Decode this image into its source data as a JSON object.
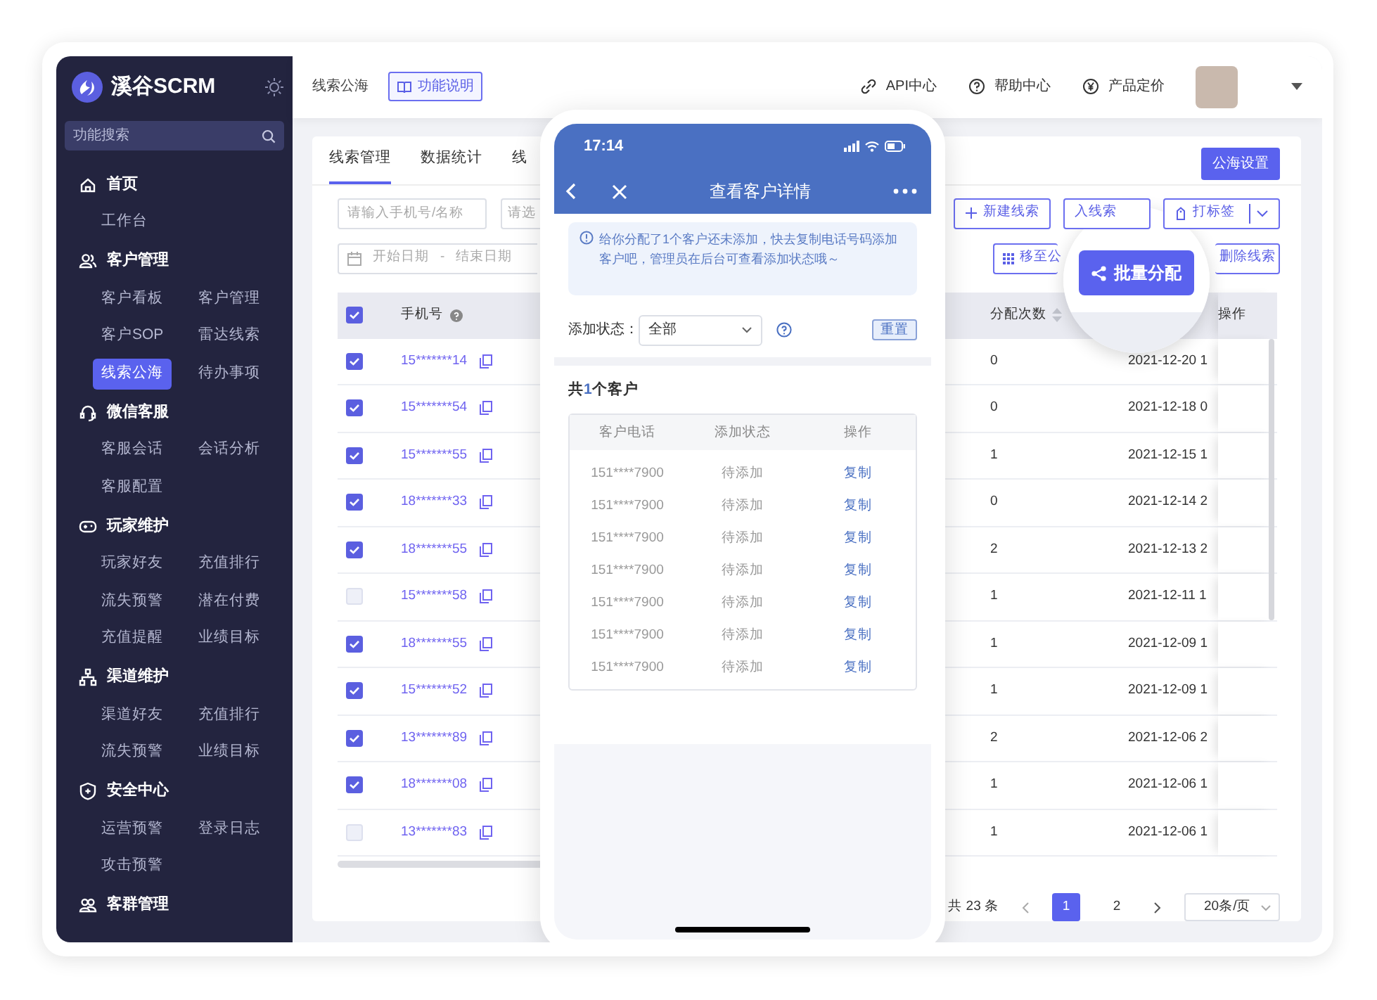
{
  "sidebar": {
    "logo_text": "溪谷SCRM",
    "search": {
      "placeholder": "功能搜索"
    },
    "groups": [
      {
        "title": "首页",
        "items": [
          {
            "label": "工作台",
            "selected": false
          }
        ]
      },
      {
        "title": "客户管理",
        "items": [
          {
            "label": "客户看板",
            "selected": false
          },
          {
            "label": "客户管理",
            "selected": false
          },
          {
            "label": "客户SOP",
            "selected": false
          },
          {
            "label": "雷达线索",
            "selected": false
          },
          {
            "label": "线索公海",
            "selected": true
          },
          {
            "label": "待办事项",
            "selected": false
          }
        ]
      },
      {
        "title": "微信客服",
        "items": [
          {
            "label": "客服会话",
            "selected": false
          },
          {
            "label": "会话分析",
            "selected": false
          },
          {
            "label": "客服配置",
            "selected": false
          }
        ]
      },
      {
        "title": "玩家维护",
        "items": [
          {
            "label": "玩家好友",
            "selected": false
          },
          {
            "label": "充值排行",
            "selected": false
          },
          {
            "label": "流失预警",
            "selected": false
          },
          {
            "label": "潜在付费",
            "selected": false
          },
          {
            "label": "充值提醒",
            "selected": false
          },
          {
            "label": "业绩目标",
            "selected": false
          }
        ]
      },
      {
        "title": "渠道维护",
        "items": [
          {
            "label": "渠道好友",
            "selected": false
          },
          {
            "label": "充值排行",
            "selected": false
          },
          {
            "label": "流失预警",
            "selected": false
          },
          {
            "label": "业绩目标",
            "selected": false
          }
        ]
      },
      {
        "title": "安全中心",
        "items": [
          {
            "label": "运营预警",
            "selected": false
          },
          {
            "label": "登录日志",
            "selected": false
          },
          {
            "label": "攻击预警",
            "selected": false
          }
        ]
      },
      {
        "title": "客群管理"
      }
    ]
  },
  "topbar": {
    "breadcrumb": "线索公海",
    "help_button": "功能说明",
    "links": [
      {
        "label": "API中心"
      },
      {
        "label": "帮助中心"
      },
      {
        "label": "产品定价"
      }
    ]
  },
  "tabs": [
    {
      "label": "线索管理",
      "selected": true
    },
    {
      "label": "数据统计",
      "selected": false
    },
    {
      "label": "线",
      "selected": false
    }
  ],
  "settings_button": "公海设置",
  "filters": {
    "search_placeholder": "请输入手机号/名称",
    "select_placeholder": "请选",
    "date_start": "开始日期",
    "date_separator": "-",
    "date_end": "结束日期"
  },
  "actions_row1": [
    {
      "label": "新建线索"
    },
    {
      "label": "入线索"
    },
    {
      "label": "打标签"
    }
  ],
  "actions_row2": [
    {
      "label": "移至公"
    },
    {
      "label": "删除线索"
    }
  ],
  "highlight_button": "批量分配",
  "table": {
    "select_all": {
      "checked": true
    },
    "columns": [
      "手机号",
      "分配次数",
      "操作"
    ],
    "rows": [
      {
        "checked": true,
        "phone": "15*******14",
        "count": "0",
        "date": "2021-12-20 1"
      },
      {
        "checked": true,
        "phone": "15*******54",
        "count": "0",
        "date": "2021-12-18 0"
      },
      {
        "checked": true,
        "phone": "15*******55",
        "count": "1",
        "date": "2021-12-15 1"
      },
      {
        "checked": true,
        "phone": "18*******33",
        "count": "0",
        "date": "2021-12-14 2"
      },
      {
        "checked": true,
        "phone": "18*******55",
        "count": "2",
        "date": "2021-12-13 2"
      },
      {
        "checked": false,
        "phone": "15*******58",
        "count": "1",
        "date": "2021-12-11 1"
      },
      {
        "checked": true,
        "phone": "18*******55",
        "count": "1",
        "date": "2021-12-09 1"
      },
      {
        "checked": true,
        "phone": "15*******52",
        "count": "1",
        "date": "2021-12-09 1"
      },
      {
        "checked": true,
        "phone": "13*******89",
        "count": "2",
        "date": "2021-12-06 2"
      },
      {
        "checked": true,
        "phone": "18*******08",
        "count": "1",
        "date": "2021-12-06 1"
      },
      {
        "checked": false,
        "phone": "13*******83",
        "count": "1",
        "date": "2021-12-06 1"
      }
    ]
  },
  "pagination": {
    "total": "共 23 条",
    "pages": [
      {
        "label": "1",
        "selected": true
      },
      {
        "label": "2",
        "selected": false
      }
    ],
    "page_size": "20条/页"
  },
  "phone": {
    "time": "17:14",
    "title": "查看客户详情",
    "notice": "给你分配了1个客户还未添加，快去复制电话号码添加客户吧，管理员在后台可查看添加状态哦～",
    "filter_label": "添加状态：",
    "filter_value": "全部",
    "reset_button": "重置",
    "count_prefix": "共",
    "count": "1",
    "count_suffix": "个客户",
    "columns": [
      "客户电话",
      "添加状态",
      "操作"
    ],
    "rows": [
      {
        "phone": "151****7900",
        "status": "待添加",
        "action": "复制"
      },
      {
        "phone": "151****7900",
        "status": "待添加",
        "action": "复制"
      },
      {
        "phone": "151****7900",
        "status": "待添加",
        "action": "复制"
      },
      {
        "phone": "151****7900",
        "status": "待添加",
        "action": "复制"
      },
      {
        "phone": "151****7900",
        "status": "待添加",
        "action": "复制"
      },
      {
        "phone": "151****7900",
        "status": "待添加",
        "action": "复制"
      },
      {
        "phone": "151****7900",
        "status": "待添加",
        "action": "复制"
      }
    ]
  }
}
